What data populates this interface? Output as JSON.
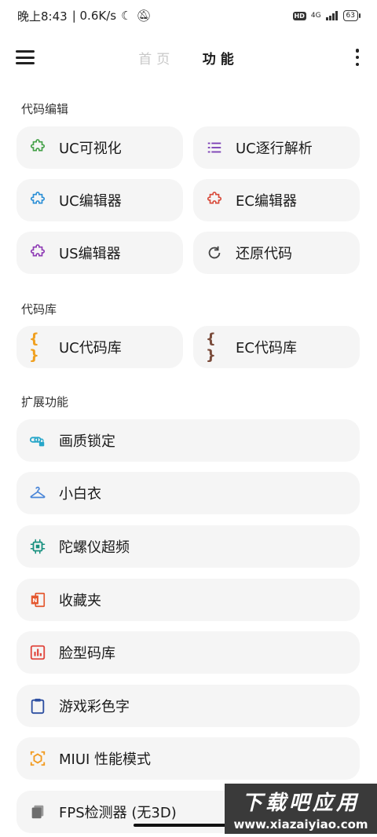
{
  "status": {
    "time": "晚上8:43",
    "speed": "| 0.6K/s",
    "hd": "HD",
    "network": "4G",
    "battery": "63"
  },
  "header": {
    "tabs": [
      "首页",
      "功能"
    ],
    "active_tab": "功能"
  },
  "sections": {
    "code_edit": "代码编辑",
    "code_lib": "代码库",
    "ext": "扩展功能"
  },
  "code_edit_items": [
    "UC可视化",
    "UC逐行解析",
    "UC编辑器",
    "EC编辑器",
    "US编辑器",
    "还原代码"
  ],
  "code_lib_items": [
    "UC代码库",
    "EC代码库"
  ],
  "ext_items": [
    "画质锁定",
    "小白衣",
    "陀螺仪超频",
    "收藏夹",
    "脸型码库",
    "游戏彩色字",
    "MIUI 性能模式",
    "FPS检测器 (无3D)"
  ],
  "watermark": {
    "line1": "下载吧应用",
    "line2": "www.xiazaiyiao.com"
  }
}
